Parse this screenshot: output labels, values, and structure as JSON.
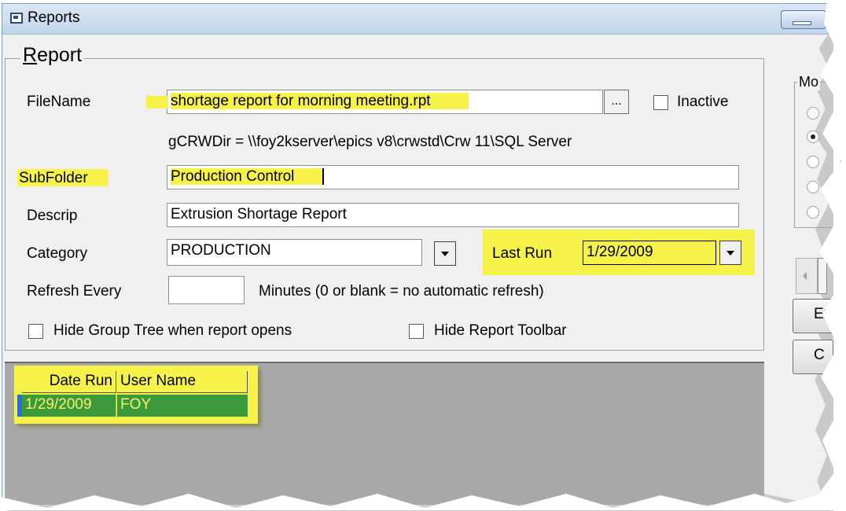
{
  "window": {
    "title": "Reports"
  },
  "report": {
    "legend": "Report",
    "legend_mnemonic": "R",
    "legend_rest": "eport",
    "filename": {
      "label": "FileName",
      "value": "shortage report for morning meeting.rpt",
      "browse_label": "..."
    },
    "inactive": {
      "label": "Inactive",
      "checked": false
    },
    "crw_dir": "gCRWDir = \\\\foy2kserver\\epics v8\\crwstd\\Crw 11\\SQL Server",
    "subfolder": {
      "label": "SubFolder",
      "value": "Production Control"
    },
    "descrip": {
      "label": "Descrip",
      "value": "Extrusion Shortage Report"
    },
    "category": {
      "label": "Category",
      "value": "PRODUCTION"
    },
    "last_run": {
      "label": "Last Run",
      "value": "1/29/2009"
    },
    "refresh": {
      "label": "Refresh Every",
      "value": "",
      "hint": "Minutes (0 or blank = no automatic refresh)"
    },
    "hide_group_tree": {
      "label": "Hide Group Tree when report opens",
      "checked": false
    },
    "hide_toolbar": {
      "label": "Hide Report Toolbar",
      "checked": false
    }
  },
  "history": {
    "columns": [
      "Date Run",
      "User Name"
    ],
    "rows": [
      {
        "date_run": "1/29/2009",
        "user_name": "FOY"
      }
    ]
  },
  "side": {
    "mode_legend": "Mo",
    "radios": [
      {
        "checked": false
      },
      {
        "checked": true
      },
      {
        "checked": false
      },
      {
        "checked": false
      },
      {
        "checked": false
      }
    ],
    "btn1_label": "Ex",
    "btn2_label": "C"
  },
  "colors": {
    "highlight": "#f7f24a",
    "row_green": "#3c9a3c"
  }
}
